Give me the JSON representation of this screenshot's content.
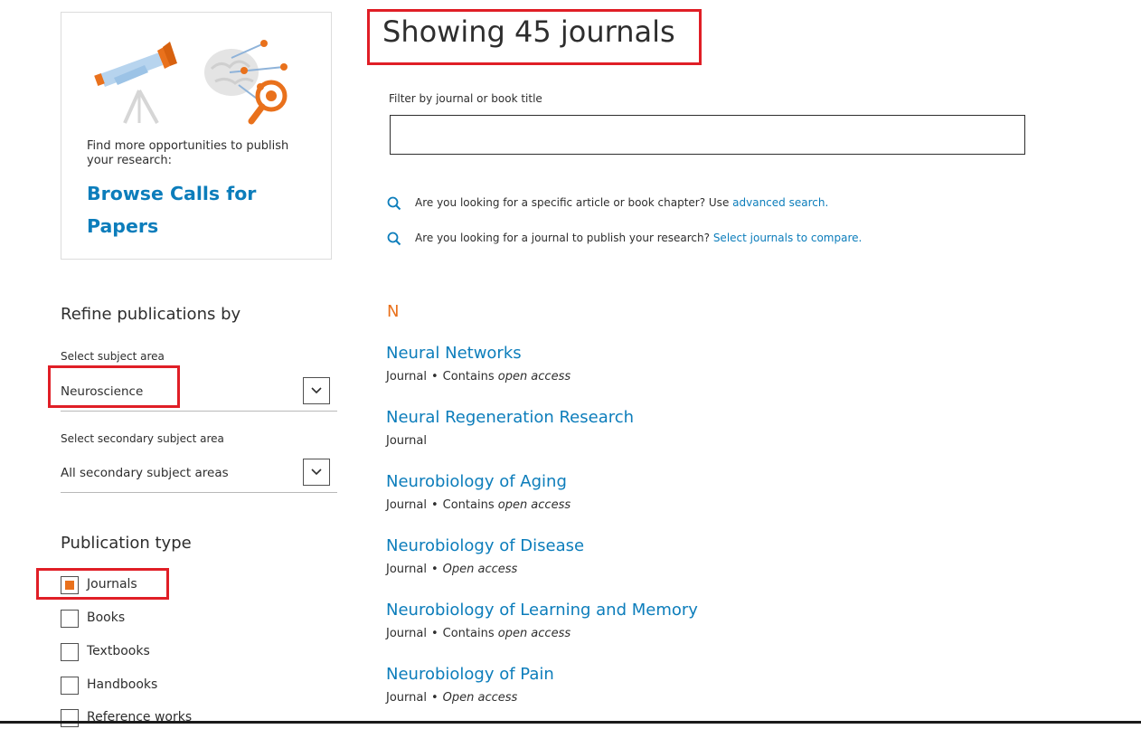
{
  "promo": {
    "text": "Find more opportunities to publish your research:",
    "link": "Browse Calls for Papers"
  },
  "refine": {
    "title": "Refine publications by",
    "subject_label": "Select subject area",
    "subject_value": "Neuroscience",
    "secondary_label": "Select secondary subject area",
    "secondary_value": "All secondary subject areas"
  },
  "pubtype": {
    "title": "Publication type",
    "options": [
      {
        "label": "Journals",
        "checked": true
      },
      {
        "label": "Books",
        "checked": false
      },
      {
        "label": "Textbooks",
        "checked": false
      },
      {
        "label": "Handbooks",
        "checked": false
      },
      {
        "label": "Reference works",
        "checked": false
      }
    ]
  },
  "main": {
    "title": "Showing 45 journals",
    "filter_label": "Filter by journal or book title",
    "filter_value": "",
    "hint1_text": "Are you looking for a specific article or book chapter? Use ",
    "hint1_link": "advanced search.",
    "hint2_text": "Are you looking for a journal to publish your research? ",
    "hint2_link": "Select journals to compare.",
    "letter": "N"
  },
  "journals": [
    {
      "title": "Neural Networks",
      "type": "Journal",
      "access_prefix": "Contains ",
      "access": "open access"
    },
    {
      "title": "Neural Regeneration Research",
      "type": "Journal",
      "access_prefix": "",
      "access": ""
    },
    {
      "title": "Neurobiology of Aging",
      "type": "Journal",
      "access_prefix": "Contains ",
      "access": "open access"
    },
    {
      "title": "Neurobiology of Disease",
      "type": "Journal",
      "access_prefix": "",
      "access": "Open access"
    },
    {
      "title": "Neurobiology of Learning and Memory",
      "type": "Journal",
      "access_prefix": "Contains ",
      "access": "open access"
    },
    {
      "title": "Neurobiology of Pain",
      "type": "Journal",
      "access_prefix": "",
      "access": "Open access"
    }
  ],
  "colors": {
    "accent": "#e9711c",
    "link": "#0c7dbb",
    "highlight": "#e01e26"
  },
  "icons": [
    "telescope-icon",
    "brain-network-icon",
    "search-icon",
    "chevron-down-icon"
  ]
}
